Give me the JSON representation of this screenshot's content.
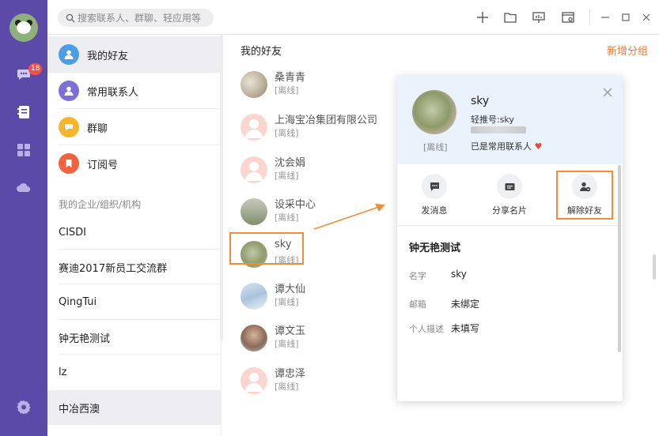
{
  "rail": {
    "badge": "18"
  },
  "search": {
    "placeholder": "搜索联系人、群聊、轻应用等"
  },
  "sidebar": {
    "items": [
      {
        "label": "我的好友",
        "color": "#4d9ce6"
      },
      {
        "label": "常用联系人",
        "color": "#7c6fd6"
      },
      {
        "label": "群聊",
        "color": "#f5b52f"
      },
      {
        "label": "订阅号",
        "color": "#f2623f"
      }
    ],
    "section_title": "我的企业/组织/机构",
    "orgs": [
      "CISDI",
      "赛迪2017新员工交流群",
      "QingTui",
      "钟无艳测试",
      "lz",
      "中冶西澳"
    ]
  },
  "list": {
    "title": "我的好友",
    "add_group": "新增分组",
    "friends": [
      {
        "name": "桑青青",
        "status": "[离线]"
      },
      {
        "name": "上海宝冶集团有限公司",
        "status": "[离线]"
      },
      {
        "name": "沈会娟",
        "status": "[离线]"
      },
      {
        "name": "设采中心",
        "status": "[离线]"
      },
      {
        "name": "sky",
        "status": "[离线]"
      },
      {
        "name": "谭大仙",
        "status": "[离线]"
      },
      {
        "name": "谭文玉",
        "status": "[离线]"
      },
      {
        "name": "谭忠泽",
        "status": "[离线]"
      }
    ]
  },
  "card": {
    "status": "[离线]",
    "name": "sky",
    "id_label": "轻推号:sky",
    "favorite": "已是常用联系人",
    "actions": [
      {
        "label": "发消息"
      },
      {
        "label": "分享名片"
      },
      {
        "label": "解除好友"
      }
    ],
    "org": "钟无艳测试",
    "rows": [
      {
        "key": "名字",
        "value": "sky"
      },
      {
        "key": "邮箱",
        "value": "未绑定"
      },
      {
        "key": "个人描述",
        "value": "未填写"
      }
    ]
  },
  "colors": {
    "rail": "#5b4aa8",
    "accent": "#f07f37"
  }
}
